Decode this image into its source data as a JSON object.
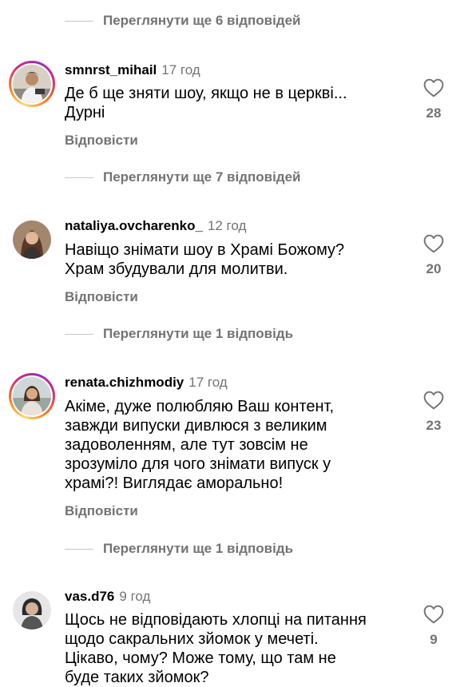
{
  "view_replies": [
    {
      "label": "Переглянути ще 6 відповідей"
    },
    {
      "label": "Переглянути ще 7 відповідей"
    },
    {
      "label": "Переглянути ще 1 відповідь"
    },
    {
      "label": "Переглянути ще 1 відповідь"
    }
  ],
  "comments": [
    {
      "username": "smnrst_mihail",
      "time": "17 год",
      "lines": [
        "Де б ще зняти шоу, якщо не в церкві...",
        "Дурні"
      ],
      "reply_label": "Відповісти",
      "likes": "28",
      "has_story": true
    },
    {
      "username": "nataliya.ovcharenko_",
      "time": "12 год",
      "lines": [
        "Навіщо знімати шоу в Храмі Божому?",
        "Храм збудували для молитви."
      ],
      "reply_label": "Відповісти",
      "likes": "20",
      "has_story": false
    },
    {
      "username": "renata.chizhmodiy",
      "time": "17 год",
      "lines": [
        "Акіме, дуже полюбляю Ваш контент,",
        "завжди випуски дивлюся з великим",
        "задоволенням, але тут зовсім не",
        "зрозуміло для чого знімати випуск у",
        "храмі?! Виглядає аморально!"
      ],
      "reply_label": "Відповісти",
      "likes": "23",
      "has_story": true
    },
    {
      "username": "vas.d76",
      "time": "9 год",
      "lines": [
        "Щось не відповідають хлопці на питання",
        "щодо сакральних зйомок у мечеті.",
        "Цікаво, чому? Може тому, що там не",
        "буде таких зйомок?"
      ],
      "likes": "9",
      "has_story": false
    }
  ],
  "colors": {
    "secondary_text": "#737373",
    "divider": "#c7c7c7",
    "story_ring": [
      "#feda75",
      "#fa7e1e",
      "#d62976",
      "#962fbf"
    ]
  },
  "icons": {
    "like": "heart-outline-icon"
  }
}
